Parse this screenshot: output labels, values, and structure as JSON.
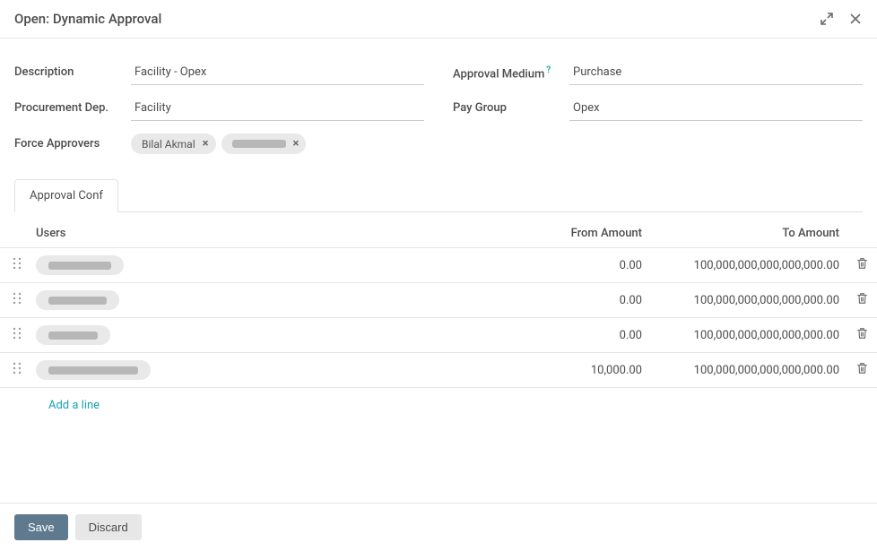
{
  "header": {
    "title": "Open: Dynamic Approval"
  },
  "form": {
    "description": {
      "label": "Description",
      "value": "Facility - Opex"
    },
    "approval_medium": {
      "label": "Approval Medium",
      "value": "Purchase"
    },
    "procurement_dep": {
      "label": "Procurement Dep.",
      "value": "Facility"
    },
    "pay_group": {
      "label": "Pay Group",
      "value": "Opex"
    },
    "force_approvers": {
      "label": "Force Approvers",
      "tags": [
        {
          "text": "Bilal Akmal",
          "redacted": false,
          "width": 0
        },
        {
          "text": "",
          "redacted": true,
          "width": 60
        }
      ]
    }
  },
  "tabs": {
    "approval_conf": "Approval Conf"
  },
  "table": {
    "headers": {
      "users": "Users",
      "from": "From Amount",
      "to": "To Amount"
    },
    "rows": [
      {
        "user_redacted_width": 70,
        "from": "0.00",
        "to": "100,000,000,000,000,000.00"
      },
      {
        "user_redacted_width": 65,
        "from": "0.00",
        "to": "100,000,000,000,000,000.00"
      },
      {
        "user_redacted_width": 55,
        "from": "0.00",
        "to": "100,000,000,000,000,000.00"
      },
      {
        "user_redacted_width": 100,
        "from": "10,000.00",
        "to": "100,000,000,000,000,000.00"
      }
    ],
    "add_line": "Add a line"
  },
  "footer": {
    "save": "Save",
    "discard": "Discard"
  }
}
